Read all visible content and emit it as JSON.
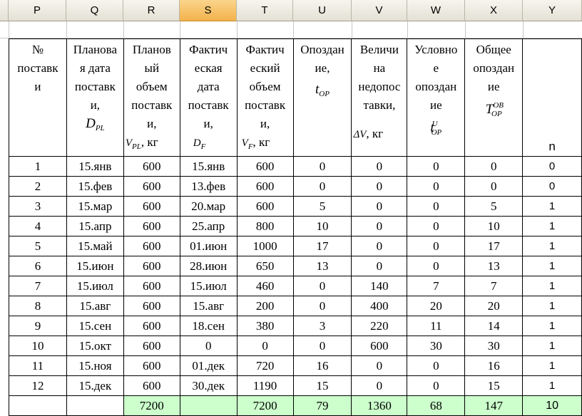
{
  "columns": [
    {
      "letter": "P",
      "width": 81
    },
    {
      "letter": "Q",
      "width": 80
    },
    {
      "letter": "R",
      "width": 79
    },
    {
      "letter": "S",
      "width": 80
    },
    {
      "letter": "T",
      "width": 79
    },
    {
      "letter": "U",
      "width": 82
    },
    {
      "letter": "V",
      "width": 78
    },
    {
      "letter": "W",
      "width": 81
    },
    {
      "letter": "X",
      "width": 81
    },
    {
      "letter": "Y",
      "width": 83
    }
  ],
  "active_column": "S",
  "headers": {
    "P": [
      "№",
      "поставк",
      "и"
    ],
    "Q": [
      "Планова",
      "я дата",
      "поставк",
      "и,"
    ],
    "Q_sym": "D",
    "Q_sub": "PL",
    "R": [
      "Планов",
      "ый",
      "объем",
      "поставк",
      "и,"
    ],
    "R_sym": "V",
    "R_sub": "PL",
    "R_unit": ", кг",
    "S": [
      "Фактич",
      "еская",
      "дата",
      "поставк",
      "и,"
    ],
    "S_sym": "D",
    "S_sub": "F",
    "T": [
      "Фактич",
      "еский",
      "объем",
      "поставк",
      "и,"
    ],
    "T_sym": "V",
    "T_sub": "F",
    "T_unit": ", кг",
    "U": [
      "Опоздан",
      "ие,"
    ],
    "U_sym": "t",
    "U_sub": "OP",
    "V": [
      "Величи",
      "на",
      "недопос",
      "тавки,"
    ],
    "V_sym": "ΔV",
    "V_unit": ", кг",
    "W": [
      "Условно",
      "е",
      "опоздан",
      "ие"
    ],
    "W_sym": "t",
    "W_sub": "OP",
    "W_sup": "U",
    "X": [
      "Общее",
      "опоздан",
      "ие"
    ],
    "X_sym": "T",
    "X_sub": "OP",
    "X_sup": "OB",
    "Y": "n"
  },
  "rows": [
    [
      "1",
      "15.янв",
      "600",
      "15.янв",
      "600",
      "0",
      "0",
      "0",
      "0",
      "0"
    ],
    [
      "2",
      "15.фев",
      "600",
      "13.фев",
      "600",
      "0",
      "0",
      "0",
      "0",
      "0"
    ],
    [
      "3",
      "15.мар",
      "600",
      "20.мар",
      "600",
      "5",
      "0",
      "0",
      "5",
      "1"
    ],
    [
      "4",
      "15.апр",
      "600",
      "25.апр",
      "800",
      "10",
      "0",
      "0",
      "10",
      "1"
    ],
    [
      "5",
      "15.май",
      "600",
      "01.июн",
      "1000",
      "17",
      "0",
      "0",
      "17",
      "1"
    ],
    [
      "6",
      "15.июн",
      "600",
      "28.июн",
      "650",
      "13",
      "0",
      "0",
      "13",
      "1"
    ],
    [
      "7",
      "15.июл",
      "600",
      "15.июл",
      "460",
      "0",
      "140",
      "7",
      "7",
      "1"
    ],
    [
      "8",
      "15.авг",
      "600",
      "15.авг",
      "200",
      "0",
      "400",
      "20",
      "20",
      "1"
    ],
    [
      "9",
      "15.сен",
      "600",
      "18.сен",
      "380",
      "3",
      "220",
      "11",
      "14",
      "1"
    ],
    [
      "10",
      "15.окт",
      "600",
      "0",
      "0",
      "0",
      "600",
      "30",
      "30",
      "1"
    ],
    [
      "11",
      "15.ноя",
      "600",
      "01.дек",
      "720",
      "16",
      "0",
      "0",
      "16",
      "1"
    ],
    [
      "12",
      "15.дек",
      "600",
      "30.дек",
      "1190",
      "15",
      "0",
      "0",
      "15",
      "1"
    ]
  ],
  "totals": [
    "",
    "",
    "7200",
    "",
    "7200",
    "79",
    "1360",
    "68",
    "147",
    "10"
  ],
  "colors": {
    "total_fill": "#ccffcc",
    "active_header": "#f6c46a"
  }
}
